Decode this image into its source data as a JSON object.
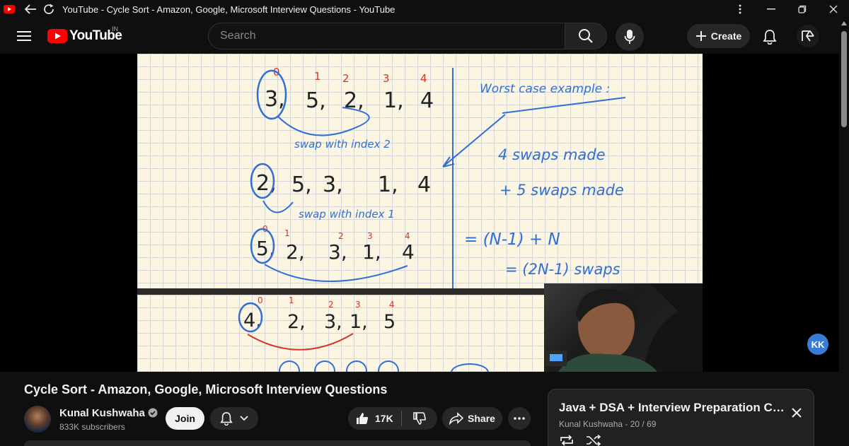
{
  "window": {
    "title": "YouTube - Cycle Sort - Amazon, Google, Microsoft Interview Questions - YouTube"
  },
  "masthead": {
    "logo_text": "YouTube",
    "country_code": "IN",
    "search_placeholder": "Search",
    "create_label": "Create"
  },
  "whiteboard": {
    "top_indices": [
      "0",
      "1",
      "2",
      "3",
      "4"
    ],
    "row1": [
      "3,",
      "5,",
      "2,",
      "1,",
      "4"
    ],
    "note1": "swap with index 2",
    "row2": [
      "2,",
      "5,",
      "3,",
      "1,",
      "4"
    ],
    "note2": "swap with index 1",
    "row3_indices": [
      "0",
      "1",
      "2",
      "3",
      "4"
    ],
    "row3": [
      "5,",
      "2,",
      "3,",
      "1,",
      "4"
    ],
    "right_title": "Worst case example :",
    "right_line1": "4 swaps made",
    "right_line2": "+ 5 swaps made",
    "right_line3": "= (N-1) + N",
    "right_line4": "= (2N-1) swaps",
    "bottom_indices": [
      "0",
      "1",
      "2",
      "3",
      "4"
    ],
    "bottom_row": [
      "4,",
      "2,",
      "3,",
      "1,",
      "5"
    ]
  },
  "video_overlay": {
    "badge_text": "KK"
  },
  "video": {
    "title": "Cycle Sort - Amazon, Google, Microsoft Interview Questions",
    "channel_name": "Kunal Kushwaha",
    "subscribers": "833K subscribers",
    "join_label": "Join",
    "likes": "17K",
    "share_label": "Share"
  },
  "playlist": {
    "title": "Java + DSA + Interview Preparation Course",
    "subtitle": "Kunal Kushwaha - 20 / 69"
  },
  "colors": {
    "background": "#0f0f0f",
    "youtube_red": "#ff0000",
    "button_bg": "#272727",
    "ink_blue": "#2f6fd6",
    "ink_red": "#d8332b",
    "paper": "#fbf5e1"
  }
}
